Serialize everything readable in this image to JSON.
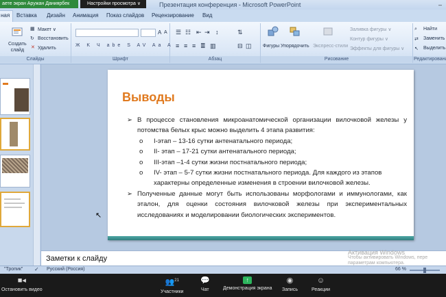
{
  "zoom_top": {
    "share_label": "аете экран Аружан Даниярбек",
    "view_options": "Настройки просмотра ∨"
  },
  "window": {
    "title": "Презентация конференция - Microsoft PowerPoint",
    "controls": "–"
  },
  "ribbon_tabs": [
    "ная",
    "Вставка",
    "Дизайн",
    "Анимация",
    "Показ слайдов",
    "Рецензирование",
    "Вид"
  ],
  "ribbon": {
    "new_slide": "Создать\nслайд",
    "layout": "Макет ∨",
    "reset": "Восстановить",
    "delete": "Удалить",
    "slides_group": "Слайды",
    "font_group": "Шрифт",
    "font_buttons": "Ж K Ч abe S AV Aa A",
    "paragraph_group": "Абзац",
    "shapes": "Фигуры",
    "arrange": "Упорядочить",
    "quick_styles": "Экспресс-стили",
    "shape_fill": "Заливка фигуры ∨",
    "shape_outline": "Контур фигуры ∨",
    "shape_effects": "Эффекты для фигуры ∨",
    "drawing_group": "Рисование",
    "find": "Найти",
    "replace": "Заменить",
    "select": "Выделить",
    "editing_group": "Редактировани"
  },
  "slide": {
    "title": "Выводы",
    "bullet1": "В процессе становления микроанатомической организации вилочковой железы у потомства белых крыс можно выделить 4 этапа развития:",
    "sub": [
      "I-этап – 13-16 сутки антенатального периода;",
      "II- этап – 17-21 сутки антенатального периода;",
      "III-этап –1-4 сутки жизни постнатального периода;",
      "IV- этап – 5-7 сутки жизни постнатального периода. Для каждого из этапов характерны определенные изменения в строении вилочковой железы."
    ],
    "bullet2": "Полученные данные могут быть использованы морфологами и иммунологами, как эталон, для оценки состояния вилочковой железы при экспериментальных исследованиях и моделировании биологических экспериментов."
  },
  "notes_placeholder": "Заметки к слайду",
  "watermark": {
    "line1": "Активация Windows",
    "line2": "Чтобы активировать Windows, пере",
    "line3": "параметрам компьютера."
  },
  "status": {
    "theme": "\"Тропик\"",
    "language": "Русский (Россия)",
    "zoom": "66 %"
  },
  "meeting_bar": {
    "stop_video": "Остановить видео",
    "participants": "Участники",
    "participants_count": "21",
    "chat": "Чат",
    "share_screen": "Демонстрация экрана",
    "record": "Запись",
    "reactions": "Реакции"
  },
  "colors": {
    "title_orange": "#e07a1f",
    "slide_bar_teal": "#2f7f7f",
    "share_green": "#2db55d"
  }
}
